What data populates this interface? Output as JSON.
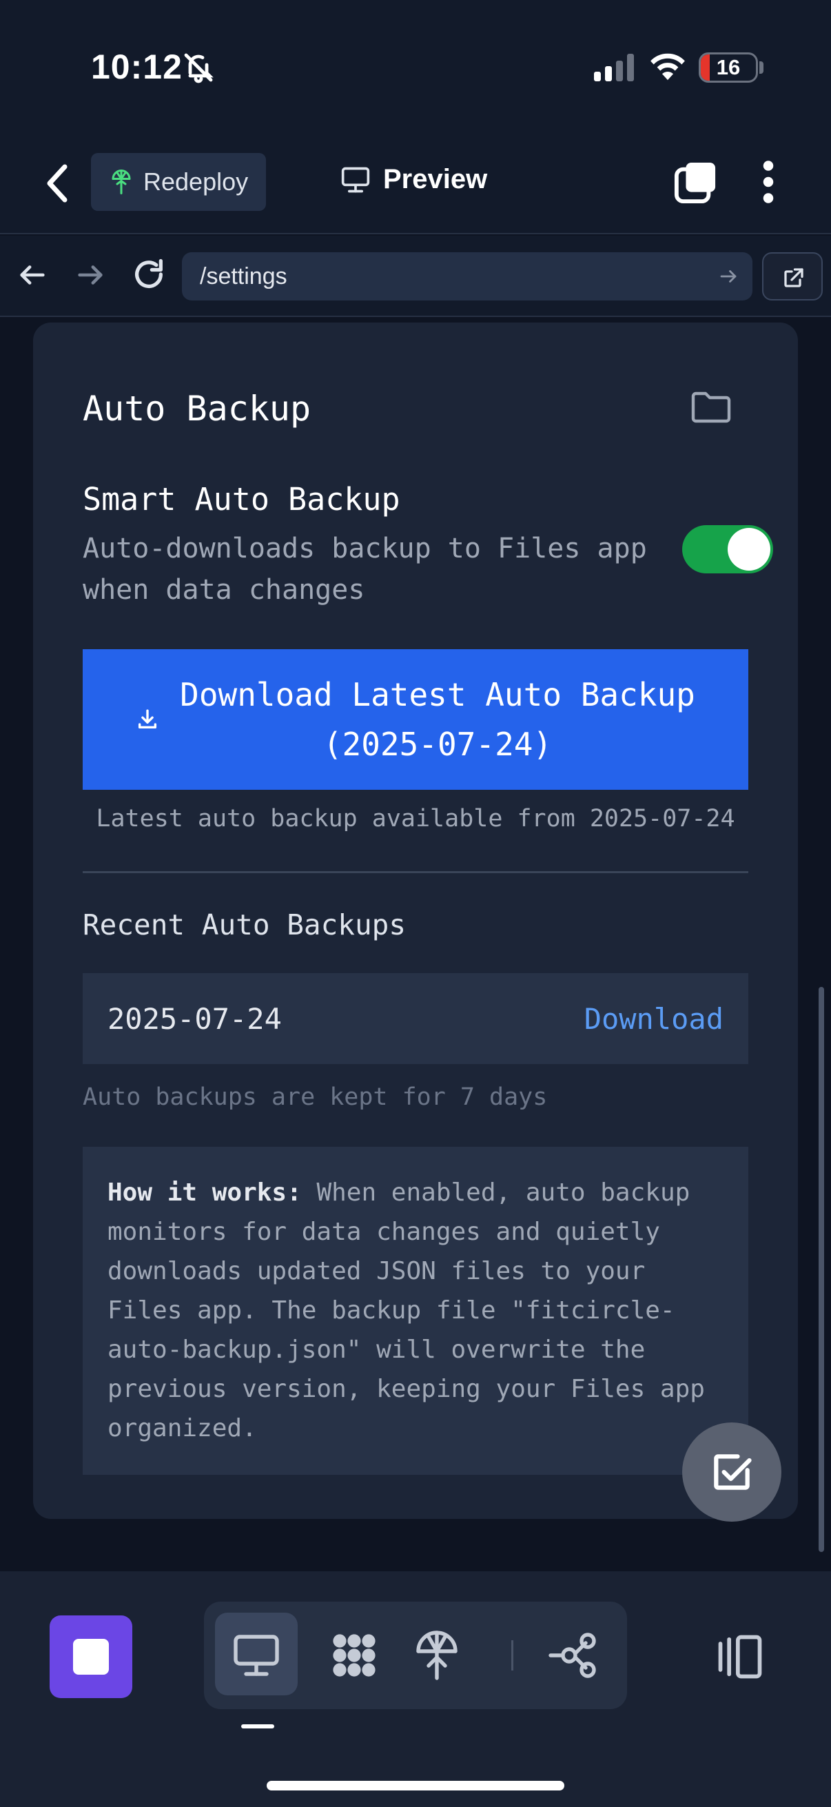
{
  "status_bar": {
    "time": "10:12",
    "battery": "16",
    "battery_level": 0.16,
    "accent_battery": "#e5352b"
  },
  "header": {
    "redeploy_label": "Redeploy",
    "preview_label": "Preview",
    "icons": [
      "chevron-left-icon",
      "redeploy-icon",
      "monitor-icon",
      "tabs-icon",
      "kebab-icon"
    ]
  },
  "browser": {
    "url": "/settings"
  },
  "auto_backup": {
    "title": "Auto Backup",
    "smart_title": "Smart Auto Backup",
    "smart_desc": "Auto-downloads backup to Files app when data changes",
    "toggle_on": true,
    "toggle_color": "#16a34a",
    "download_line1": "Download Latest Auto Backup",
    "download_line2": "(2025-07-24)",
    "download_color": "#2563eb",
    "latest_note": "Latest auto backup available from 2025-07-24",
    "recent_title": "Recent Auto Backups",
    "recent": [
      {
        "date": "2025-07-24",
        "action": "Download"
      }
    ],
    "kept_note": "Auto backups are kept for 7 days",
    "how_label": "How it works:",
    "how_text": " When enabled, auto backup monitors for data changes and quietly downloads updated JSON files to your Files app. The backup file \"fitcircle-auto-backup.json\" will overwrite the previous version, keeping your Files app organized."
  },
  "toolbar": {
    "stop_color": "#6b46e5",
    "tools": [
      "preview-tool",
      "workspace-tool",
      "deploy-tool",
      "connections-tool"
    ],
    "active_tool": "preview-tool"
  }
}
